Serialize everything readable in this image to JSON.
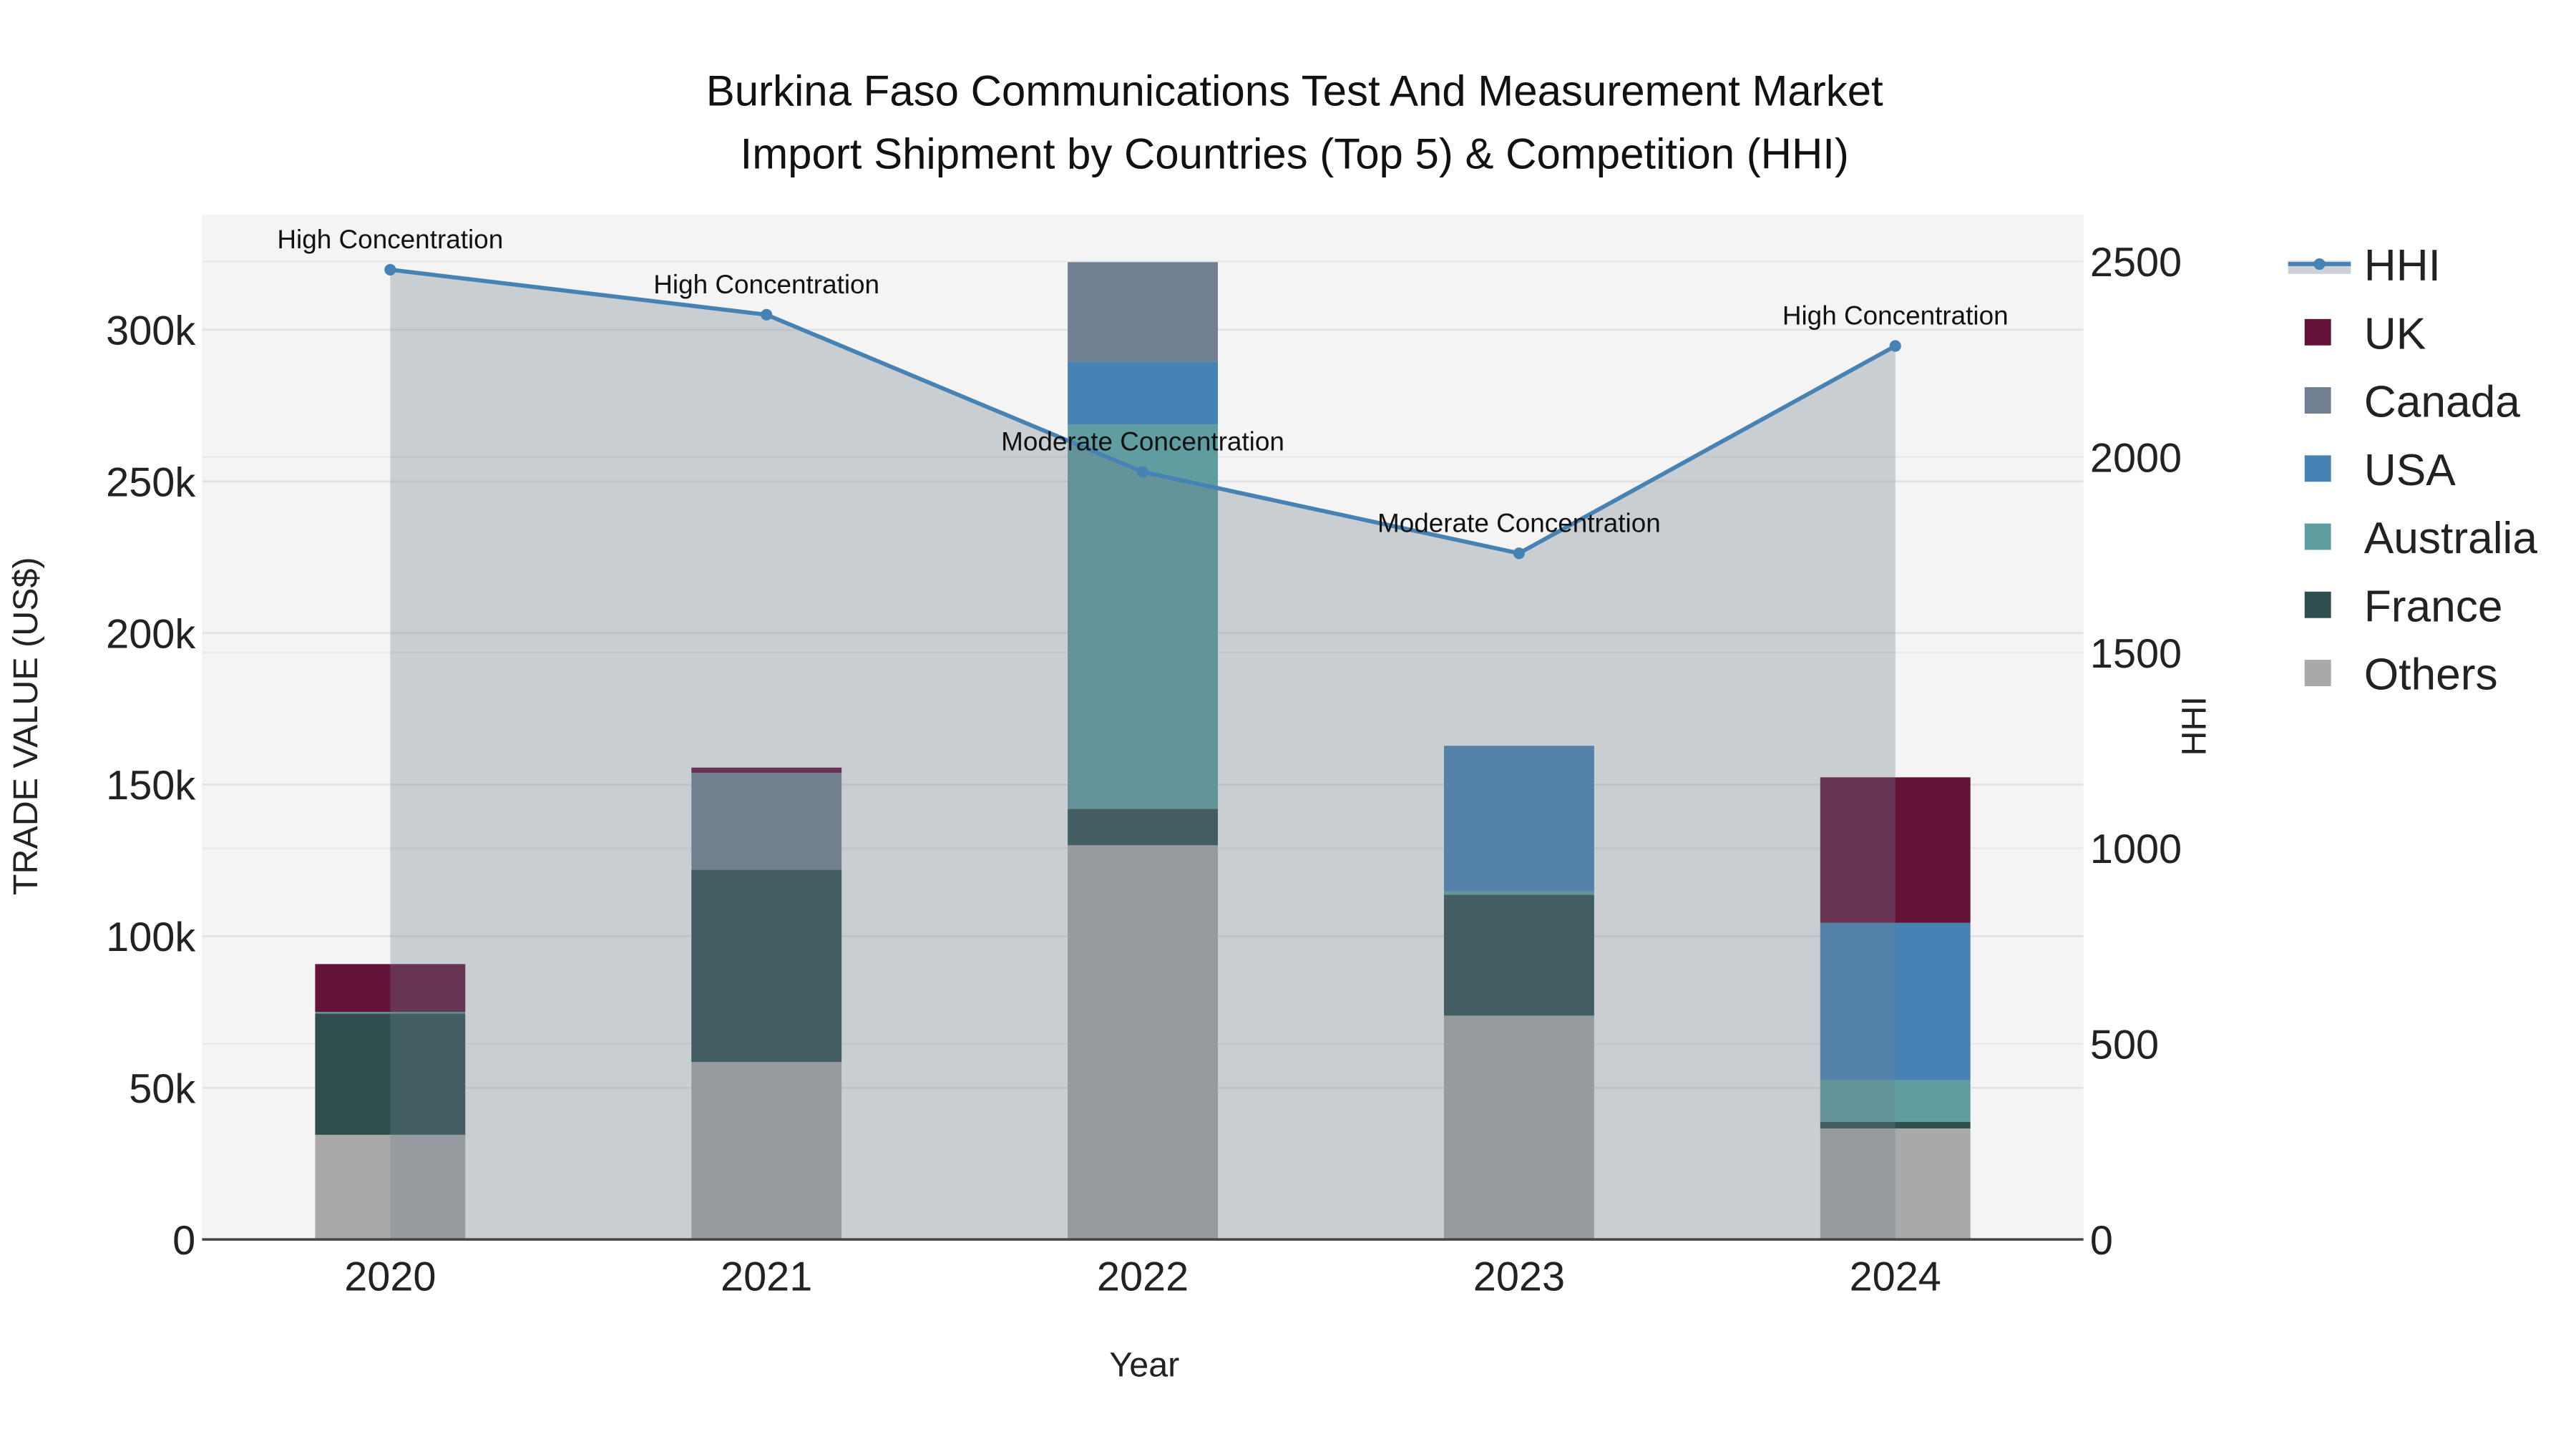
{
  "chart_data": {
    "type": "bar",
    "stacked": true,
    "title_line1": "Burkina Faso Communications Test And Measurement Market",
    "title_line2": "Import Shipment by Countries (Top 5) & Competition (HHI)",
    "xlabel": "Year",
    "ylabel": "TRADE VALUE (US$)",
    "y2label": "HHI",
    "categories": [
      "2020",
      "2021",
      "2022",
      "2023",
      "2024"
    ],
    "ylim": [
      0,
      338000
    ],
    "y_ticks": [
      0,
      50000,
      100000,
      150000,
      200000,
      250000,
      300000
    ],
    "y_tick_labels": [
      "0",
      "50k",
      "100k",
      "150k",
      "200k",
      "250k",
      "300k"
    ],
    "y2lim": [
      0,
      2620
    ],
    "y2_ticks": [
      0,
      500,
      1000,
      1500,
      2000,
      2500
    ],
    "y2_tick_labels": [
      "0",
      "500",
      "1000",
      "1500",
      "2000",
      "2500"
    ],
    "series": [
      {
        "name": "Others",
        "color": "#A9A9A9",
        "values": [
          34500,
          58500,
          130000,
          73800,
          36600
        ]
      },
      {
        "name": "France",
        "color": "#2F4F4F",
        "values": [
          40000,
          63400,
          12000,
          39900,
          2200
        ]
      },
      {
        "name": "Australia",
        "color": "#5F9EA0",
        "values": [
          500,
          0,
          126800,
          1100,
          13700
        ]
      },
      {
        "name": "USA",
        "color": "#4682B4",
        "values": [
          0,
          0,
          20700,
          48000,
          51900
        ]
      },
      {
        "name": "Canada",
        "color": "#708090",
        "values": [
          0,
          32000,
          32800,
          0,
          0
        ]
      },
      {
        "name": "UK",
        "color": "#641238",
        "values": [
          15800,
          1700,
          0,
          0,
          48000
        ]
      }
    ],
    "hhi": {
      "name": "HHI",
      "color": "#4682B4",
      "values": [
        2479,
        2364,
        1962,
        1754,
        2284
      ],
      "annotations": [
        "High Concentration",
        "High Concentration",
        "Moderate Concentration",
        "Moderate Concentration",
        "High Concentration"
      ]
    },
    "legend": [
      "HHI",
      "UK",
      "Canada",
      "USA",
      "Australia",
      "France",
      "Others"
    ],
    "legend_position": "right",
    "grid": true
  }
}
